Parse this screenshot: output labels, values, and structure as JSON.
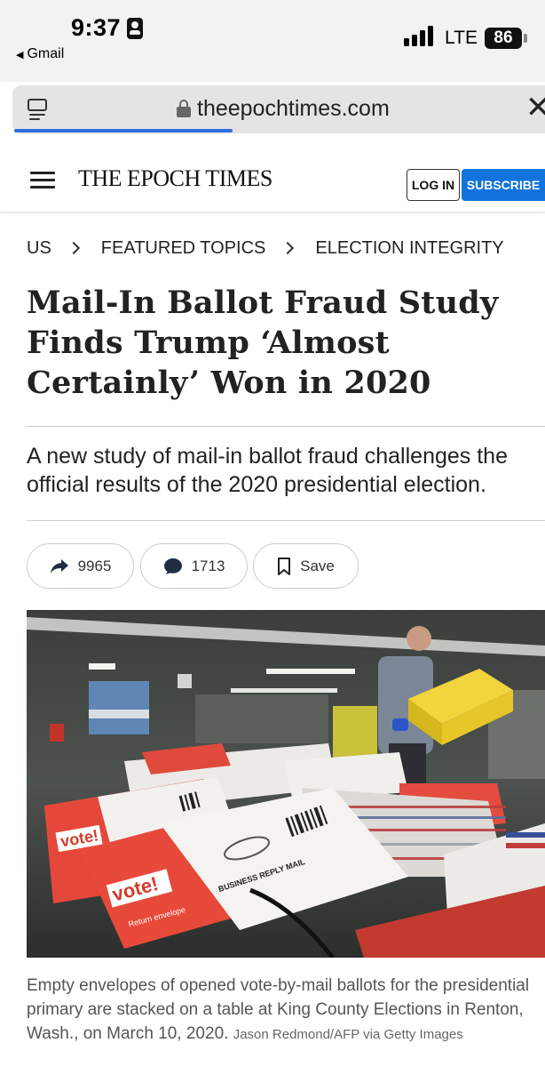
{
  "status_bar": {
    "time": "9:37",
    "back_app": "Gmail",
    "network": "LTE",
    "battery": "86"
  },
  "browser": {
    "url": "theepochtimes.com"
  },
  "site": {
    "logo": "THE EPOCH TIMES",
    "login_label": "LOG IN",
    "subscribe_label": "SUBSCRIBE",
    "accent_color": "#1173db"
  },
  "breadcrumb": [
    "US",
    "FEATURED TOPICS",
    "ELECTION INTEGRITY"
  ],
  "article": {
    "headline": "Mail-In Ballot Fraud Study Finds Trump ‘Almost Certainly’ Won in 2020",
    "subtitle": "A new study of mail-in ballot fraud challenges the official results of the 2020 presidential election.",
    "actions": {
      "shares": "9965",
      "comments": "1713",
      "save_label": "Save"
    },
    "image": {
      "envelope_brand": "vote!",
      "envelope_note": "Return envelope",
      "envelope_mail": "BUSINESS REPLY MAIL"
    },
    "caption": "Empty envelopes of opened vote-by-mail ballots for the presidential primary are stacked on a table at King County Elections in Renton, Wash., on March 10, 2020.",
    "credit": "Jason Redmond/AFP via Getty Images"
  }
}
